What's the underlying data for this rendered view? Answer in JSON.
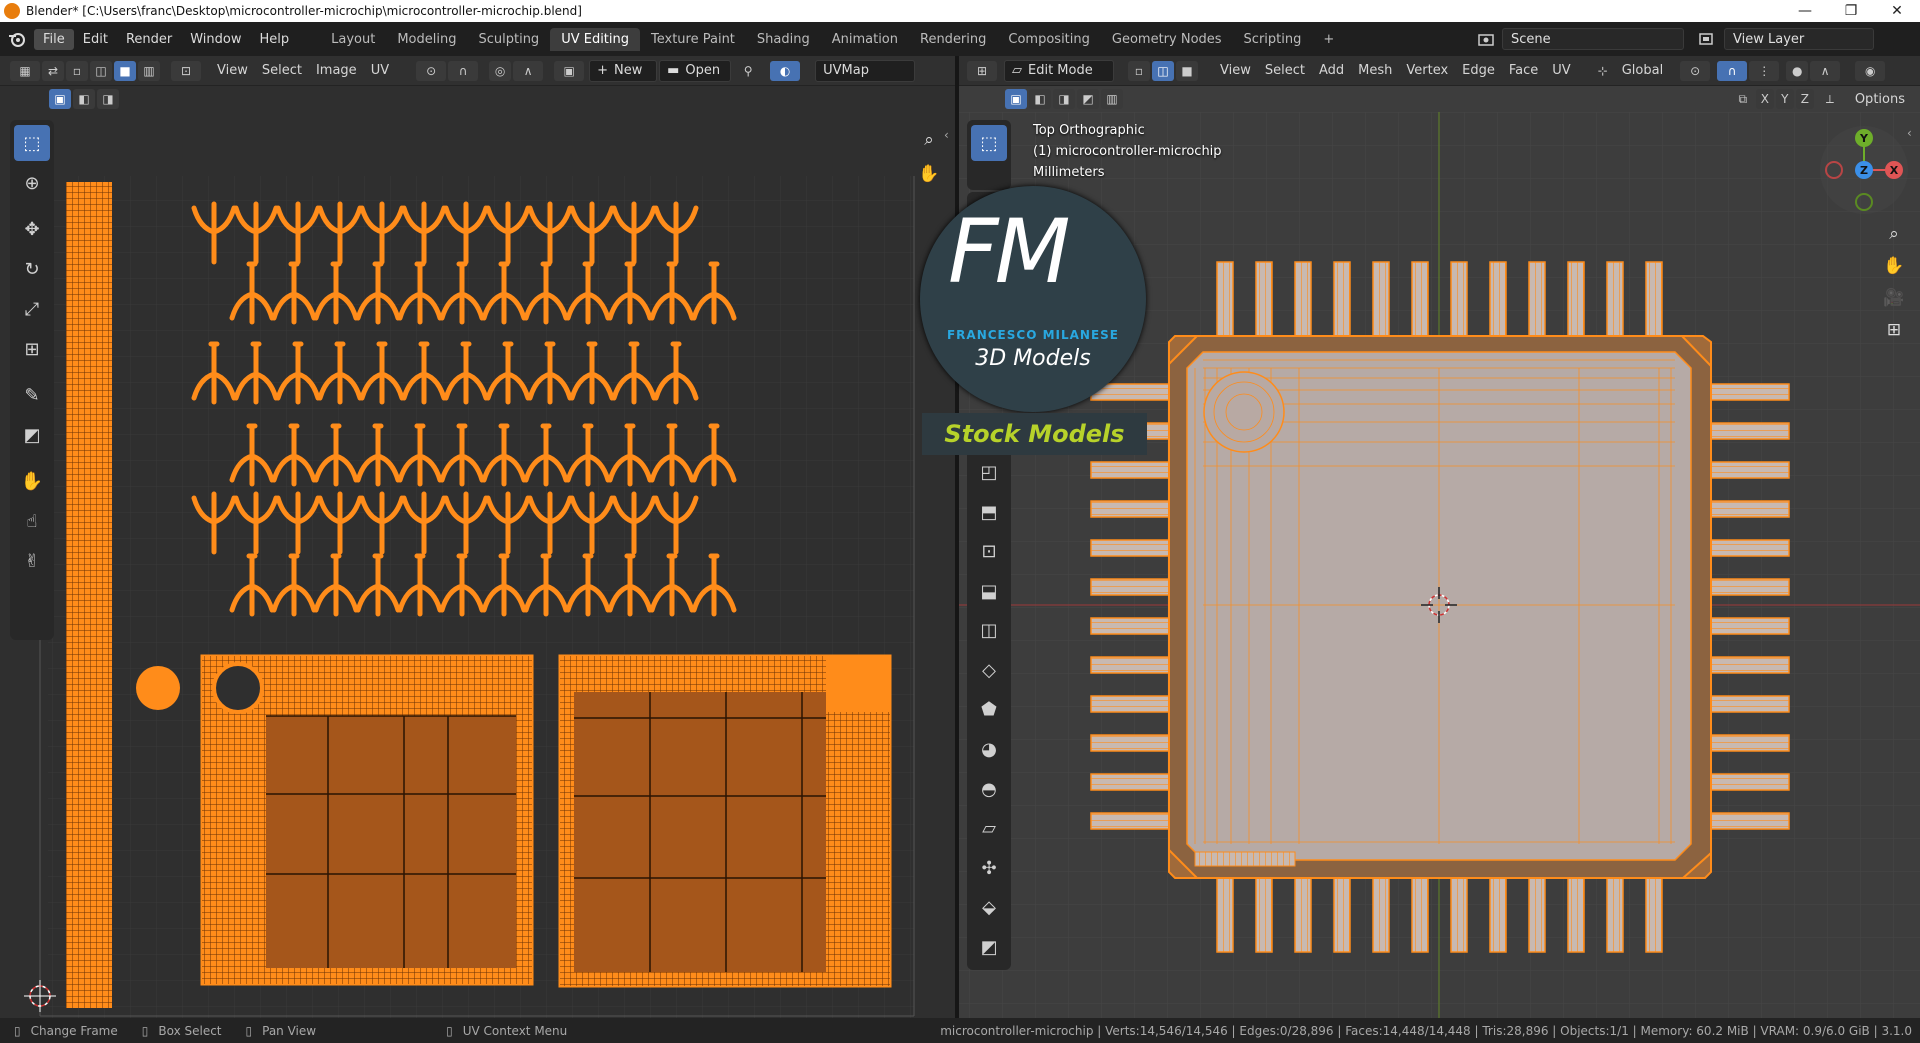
{
  "window": {
    "title": "Blender* [C:\\Users\\franc\\Desktop\\microcontroller-microchip\\microcontroller-microchip.blend]",
    "minimize": "—",
    "maximize": "❐",
    "close": "✕"
  },
  "menu": {
    "items": [
      "File",
      "Edit",
      "Render",
      "Window",
      "Help"
    ],
    "workspaces": [
      "Layout",
      "Modeling",
      "Sculpting",
      "UV Editing",
      "Texture Paint",
      "Shading",
      "Animation",
      "Rendering",
      "Compositing",
      "Geometry Nodes",
      "Scripting"
    ],
    "active_workspace": "UV Editing",
    "add_workspace": "+",
    "scene": "Scene",
    "view_layer": "View Layer"
  },
  "uv_editor": {
    "menus": [
      "View",
      "Select",
      "Image",
      "UV"
    ],
    "new_label": "New",
    "open_label": "Open",
    "uvmap": "UVMap"
  },
  "viewport": {
    "mode": "Edit Mode",
    "menus": [
      "View",
      "Select",
      "Add",
      "Mesh",
      "Vertex",
      "Edge",
      "Face",
      "UV"
    ],
    "orientation": "Global",
    "axes": [
      "X",
      "Y",
      "Z"
    ],
    "options_label": "Options",
    "overlay": {
      "view_name": "Top Orthographic",
      "object": "(1) microcontroller-microchip",
      "units": "Millimeters"
    },
    "gizmo": {
      "y": "Y",
      "z": "Z",
      "x": "X"
    }
  },
  "watermark": {
    "letters": "FM",
    "name": "FRANCESCO MILANESE",
    "subtitle": "3D Models",
    "banner": "Stock Models"
  },
  "status": {
    "change_frame": "Change Frame",
    "box_select": "Box Select",
    "pan_view": "Pan View",
    "context_menu": "UV Context Menu",
    "stats": "microcontroller-microchip | Verts:14,546/14,546 | Edges:0/28,896 | Faces:14,448/14,448 | Tris:28,896 | Objects:1/1 | Memory: 60.2 MiB | VRAM: 0.9/6.0 GiB | 3.1.0"
  },
  "colors": {
    "uv_orange": "#ff8c1a",
    "selected_blue": "#4772b3",
    "mesh_face": "#b3a9a9"
  }
}
